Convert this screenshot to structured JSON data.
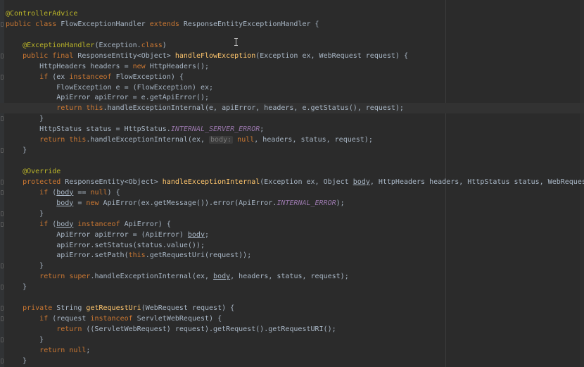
{
  "editor": {
    "language": "java",
    "theme_colors": {
      "background": "#2b2b2b",
      "keyword": "#cc7832",
      "annotation": "#bbb529",
      "method_declaration": "#ffc66d",
      "constant": "#9876aa",
      "default_text": "#a9b7c6"
    },
    "code_lines": [
      "@ControllerAdvice",
      "public class FlowExceptionHandler extends ResponseEntityExceptionHandler {",
      "",
      "    @ExceptionHandler(Exception.class)",
      "    public final ResponseEntity<Object> handleFlowException(Exception ex, WebRequest request) {",
      "        HttpHeaders headers = new HttpHeaders();",
      "        if (ex instanceof FlowException) {",
      "            FlowException e = (FlowException) ex;",
      "            ApiError apiError = e.getApiError();",
      "            return this.handleExceptionInternal(e, apiError, headers, e.getStatus(), request);",
      "        }",
      "        HttpStatus status = HttpStatus.INTERNAL_SERVER_ERROR;",
      "        return this.handleExceptionInternal(ex,  body: null, headers, status, request);",
      "    }",
      "",
      "    @Override",
      "    protected ResponseEntity<Object> handleExceptionInternal(Exception ex, Object body, HttpHeaders headers, HttpStatus status, WebRequest request) {",
      "        if (body == null) {",
      "            body = new ApiError(ex.getMessage()).error(ApiError.INTERNAL_ERROR);",
      "        }",
      "        if (body instanceof ApiError) {",
      "            ApiError apiError = (ApiError) body;",
      "            apiError.setStatus(status.value());",
      "            apiError.setPath(this.getRequestUri(request));",
      "        }",
      "        return super.handleExceptionInternal(ex, body, headers, status, request);",
      "    }",
      "",
      "    private String getRequestUri(WebRequest request) {",
      "        if (request instanceof ServletWebRequest) {",
      "            return ((ServletWebRequest) request).getRequest().getRequestURI();",
      "        }",
      "        return null;",
      "    }"
    ]
  }
}
